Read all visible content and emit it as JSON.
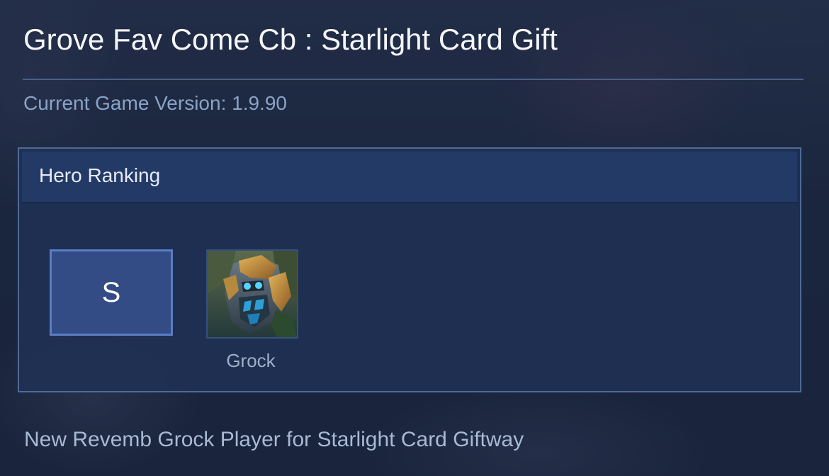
{
  "page": {
    "title": "Grove Fav Come Cb : Starlight Card Gift",
    "version_text": "Current Game Version: 1.9.90",
    "footer_text": "New Revemb Grock Player for Starlight Card Giftway"
  },
  "ranking": {
    "header": "Hero Ranking",
    "tier": "S",
    "heroes": [
      {
        "name": "Grock",
        "icon": "grock-portrait"
      }
    ]
  },
  "colors": {
    "background": "#1c2740",
    "panel": "#1f3054",
    "panel_header": "#233a66",
    "panel_border": "#4f6a96",
    "tier_box": "#344c86",
    "tier_border": "#5b7dc2",
    "version_text": "#8aa3c6"
  }
}
